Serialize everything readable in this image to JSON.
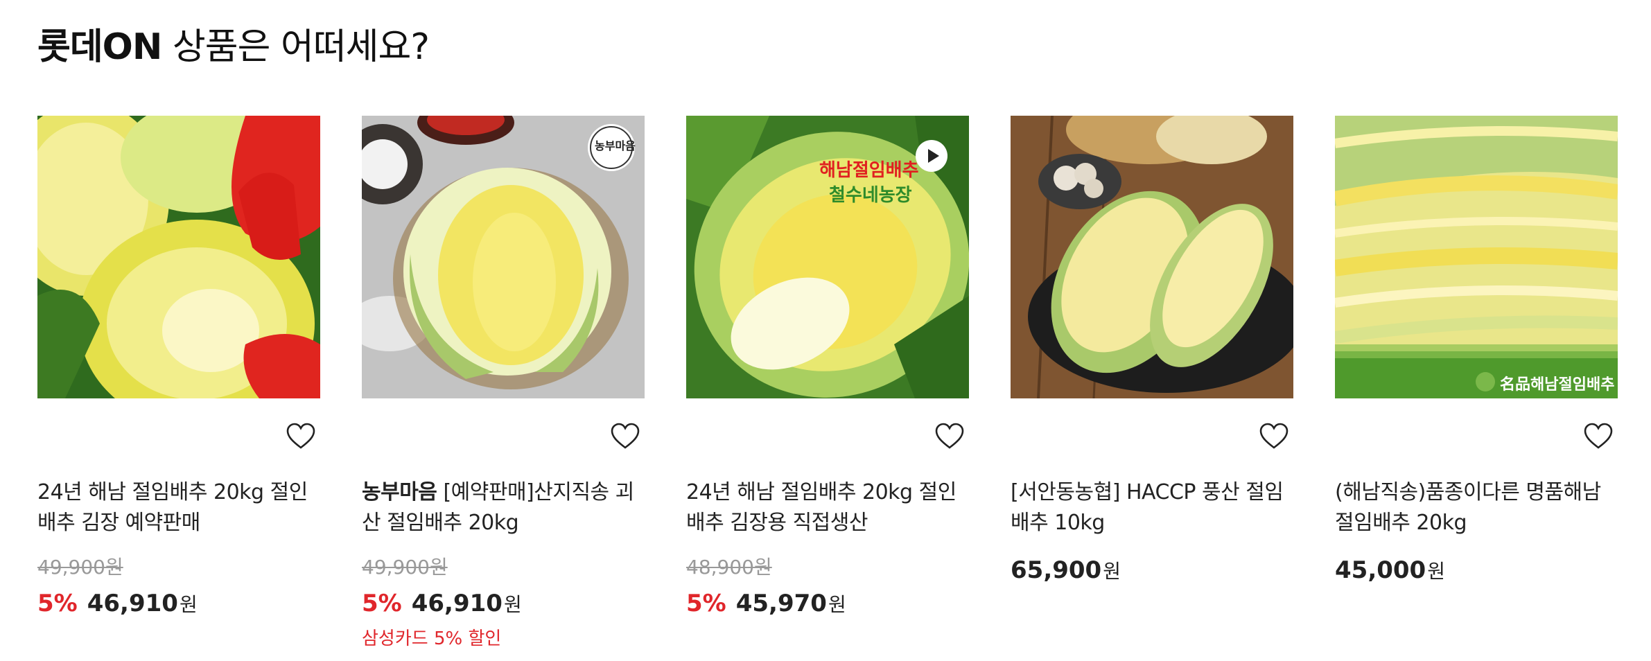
{
  "section": {
    "title_brand": "롯데ON",
    "title_rest": " 상품은 어떠세요?"
  },
  "products": [
    {
      "brand": "",
      "title": "24년 해남 절임배추 20kg 절인 배추 김장 예약판매",
      "original_price": "49,900",
      "original_unit": "원",
      "discount": "5%",
      "price": "46,910",
      "unit": "원",
      "benefit": ""
    },
    {
      "brand": "농부마음",
      "title": " [예약판매]산지직송 괴산 절임배추 20kg",
      "original_price": "49,900",
      "original_unit": "원",
      "discount": "5%",
      "price": "46,910",
      "unit": "원",
      "benefit": "삼성카드 5% 할인",
      "image_badge": "농부마음"
    },
    {
      "brand": "",
      "title": "24년 해남 절임배추 20kg 절인 배추 김장용 직접생산",
      "original_price": "48,900",
      "original_unit": "원",
      "discount": "5%",
      "price": "45,970",
      "unit": "원",
      "benefit": "",
      "image_text_1": "해남절임배추",
      "image_text_2": "철수네농장"
    },
    {
      "brand": "",
      "title": "[서안동농협] HACCP 풍산 절임배추 10kg",
      "original_price": "",
      "original_unit": "",
      "discount": "",
      "price": "65,900",
      "unit": "원",
      "benefit": ""
    },
    {
      "brand": "",
      "title": "(해남직송)품종이다른 명품해남절임배추 20kg",
      "original_price": "",
      "original_unit": "",
      "discount": "",
      "price": "45,000",
      "unit": "원",
      "benefit": "",
      "image_watermark": "名品해남절임배추"
    }
  ],
  "colors": {
    "discount": "#e0262b",
    "text": "#222222",
    "strike": "#999999"
  },
  "icons": [
    "heart-outline-icon",
    "play-icon"
  ]
}
